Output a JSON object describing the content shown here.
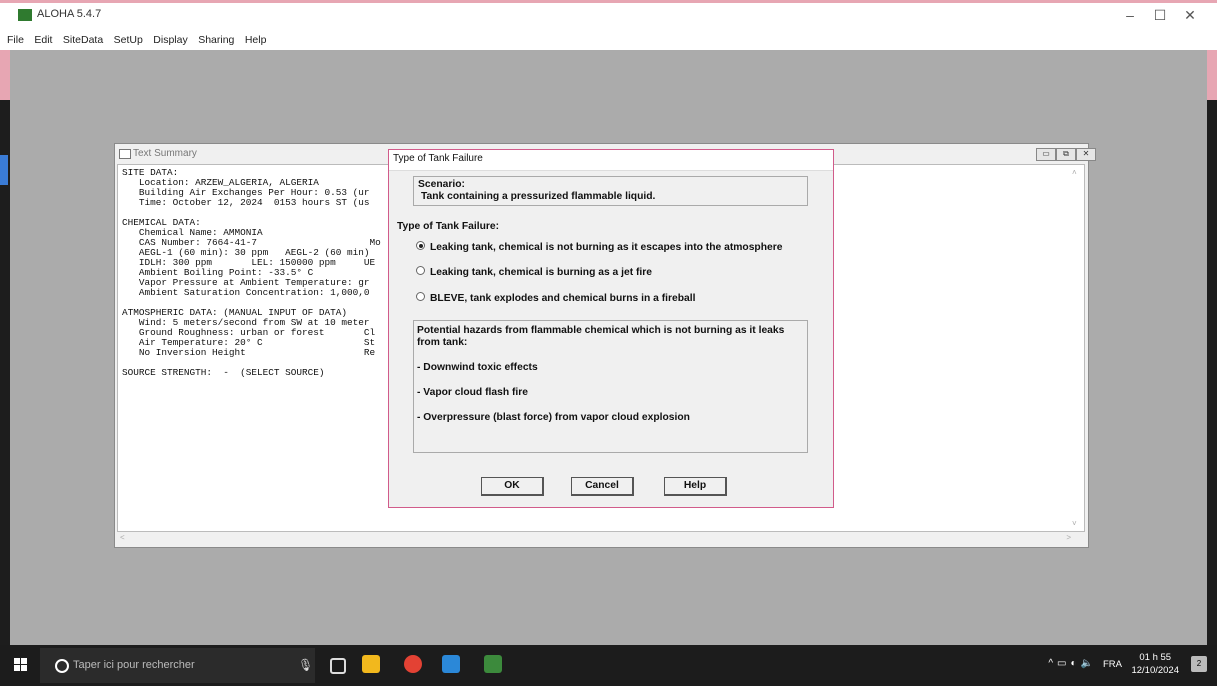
{
  "app": {
    "title": "ALOHA 5.4.7",
    "menu": [
      "File",
      "Edit",
      "SiteData",
      "SetUp",
      "Display",
      "Sharing",
      "Help"
    ],
    "window_controls": [
      "–",
      "☐",
      "✕"
    ]
  },
  "text_summary": {
    "title": "Text Summary",
    "lines": [
      "SITE DATA:",
      "   Location: ARZEW_ALGERIA, ALGERIA",
      "   Building Air Exchanges Per Hour: 0.53 (ur",
      "   Time: October 12, 2024  0153 hours ST (us",
      "",
      "CHEMICAL DATA:",
      "   Chemical Name: AMMONIA",
      "   CAS Number: 7664-41-7                    Mo",
      "   AEGL-1 (60 min): 30 ppm   AEGL-2 (60 min)",
      "   IDLH: 300 ppm       LEL: 150000 ppm     UE",
      "   Ambient Boiling Point: -33.5° C",
      "   Vapor Pressure at Ambient Temperature: gr",
      "   Ambient Saturation Concentration: 1,000,0",
      "",
      "ATMOSPHERIC DATA: (MANUAL INPUT OF DATA)",
      "   Wind: 5 meters/second from SW at 10 meter",
      "   Ground Roughness: urban or forest       Cl",
      "   Air Temperature: 20° C                  St",
      "   No Inversion Height                     Re",
      "",
      "SOURCE STRENGTH:  -  (SELECT SOURCE)"
    ]
  },
  "dialog": {
    "title": "Type of Tank Failure",
    "scenario_label": "Scenario:",
    "scenario_text": "Tank containing a pressurized flammable liquid.",
    "type_label": "Type of Tank Failure:",
    "options": [
      {
        "label": "Leaking tank, chemical is not burning as it escapes into the atmosphere",
        "selected": true
      },
      {
        "label": "Leaking tank, chemical is burning as a jet fire",
        "selected": false
      },
      {
        "label": "BLEVE, tank explodes and chemical burns in a fireball",
        "selected": false
      }
    ],
    "hazards_title": "Potential hazards from flammable chemical which is not burning as it leaks from tank:",
    "hazards": [
      "- Downwind toxic effects",
      "- Vapor cloud flash fire",
      "- Overpressure (blast force) from vapor cloud explosion"
    ],
    "buttons": {
      "ok": "OK",
      "cancel": "Cancel",
      "help": "Help"
    }
  },
  "taskbar": {
    "search_placeholder": "Taper ici pour rechercher",
    "language": "FRA",
    "time": "01 h 55",
    "date": "12/10/2024",
    "notifications": "2"
  }
}
